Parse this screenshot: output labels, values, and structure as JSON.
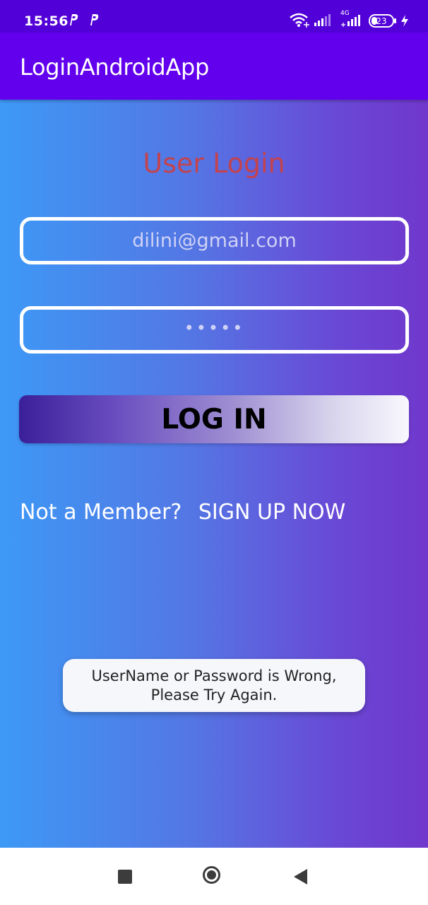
{
  "status_bar": {
    "time": "15:56",
    "icons": [
      "p-notification-icon",
      "p-notification-icon",
      "wifi-icon",
      "signal-icon",
      "signal-4g-icon",
      "battery-icon",
      "charging-icon"
    ],
    "network_type": "4G",
    "battery_level": "23"
  },
  "app_bar": {
    "title": "LoginAndroidApp"
  },
  "login": {
    "title": "User Login",
    "email_value": "dilini@gmail.com",
    "password_value": "•••••",
    "login_button_label": "LOG IN",
    "member_prompt": "Not a Member?",
    "signup_link": "SIGN UP NOW"
  },
  "toast": {
    "line1": "UserName or Password is Wrong,",
    "line2": "Please Try Again."
  },
  "nav_bar": {
    "icons": [
      "recents-square-icon",
      "home-circle-icon",
      "back-triangle-icon"
    ]
  },
  "colors": {
    "status_bar": "#5200d8",
    "app_bar": "#6200ee",
    "title_text": "#c2434e",
    "gradient_left": "#3d99f6",
    "gradient_right": "#7037cc"
  }
}
